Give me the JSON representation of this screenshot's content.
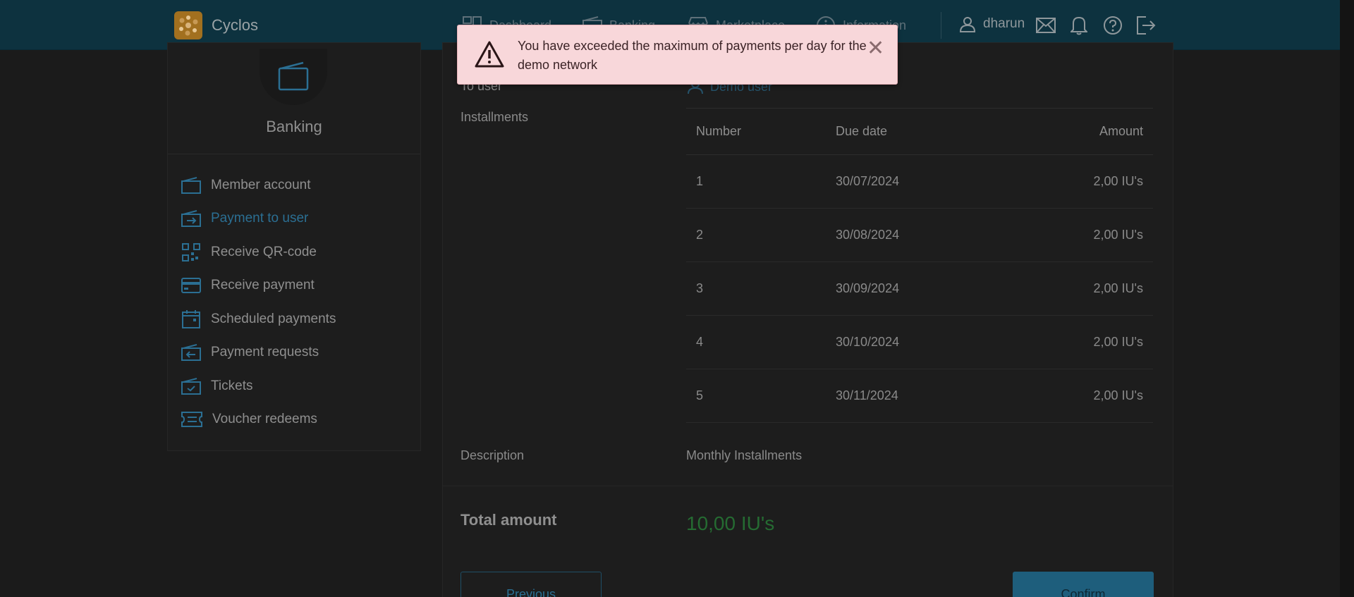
{
  "header": {
    "brand": "Cyclos",
    "nav": [
      {
        "label": "Dashboard",
        "icon": "dashboard-icon"
      },
      {
        "label": "Banking",
        "icon": "wallet-icon"
      },
      {
        "label": "Marketplace",
        "icon": "store-icon"
      },
      {
        "label": "Information",
        "icon": "info-icon"
      }
    ],
    "username": "dharun"
  },
  "alert": {
    "message": "You have exceeded the maximum of payments per day for the demo network",
    "close_symbol": "✕"
  },
  "sidebar": {
    "title": "Banking",
    "items": [
      {
        "label": "Member account",
        "icon": "wallet-icon"
      },
      {
        "label": "Payment to user",
        "icon": "wallet-arrow-icon",
        "active": true
      },
      {
        "label": "Receive QR-code",
        "icon": "qr-code-icon"
      },
      {
        "label": "Receive payment",
        "icon": "credit-card-icon"
      },
      {
        "label": "Scheduled payments",
        "icon": "calendar-icon"
      },
      {
        "label": "Payment requests",
        "icon": "wallet-arrow-left-icon"
      },
      {
        "label": "Tickets",
        "icon": "ticket-check-icon"
      },
      {
        "label": "Voucher redeems",
        "icon": "voucher-icon"
      }
    ]
  },
  "main": {
    "to_user_label": "To user",
    "to_user_value": "Demo user",
    "installments_label": "Installments",
    "table": {
      "headers": [
        "Number",
        "Due date",
        "Amount"
      ],
      "rows": [
        [
          "1",
          "30/07/2024",
          "2,00 IU's"
        ],
        [
          "2",
          "30/08/2024",
          "2,00 IU's"
        ],
        [
          "3",
          "30/09/2024",
          "2,00 IU's"
        ],
        [
          "4",
          "30/10/2024",
          "2,00 IU's"
        ],
        [
          "5",
          "30/11/2024",
          "2,00 IU's"
        ]
      ]
    },
    "description_label": "Description",
    "description_value": "Monthly Installments",
    "total_label": "Total amount",
    "total_value": "10,00 IU's",
    "previous_button": "Previous",
    "confirm_button": "Confirm"
  },
  "colors": {
    "topbar": "#0d323f",
    "accent": "#2b6f93",
    "total": "#256b32",
    "alert_bg": "#f8d7da"
  }
}
